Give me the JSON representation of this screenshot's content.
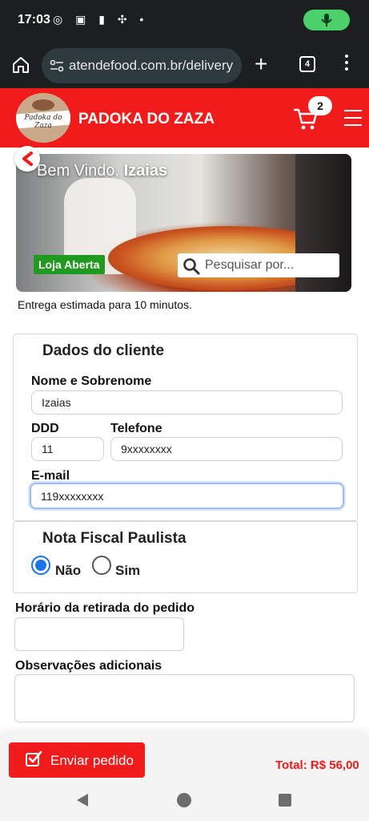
{
  "status_bar": {
    "time": "17:03",
    "notification_icons": "◎ ▣ ▮ ✣ •"
  },
  "browser": {
    "url": "atendefood.com.br/delivery",
    "tab_count": "4",
    "new_tab_symbol": "+"
  },
  "header": {
    "brand": "PADOKA DO ZAZA",
    "logo_text": "Padoka do Zaza",
    "cart_count": "2",
    "accent_color": "#f01b1b"
  },
  "banner": {
    "welcome_prefix": "Bem Vindo, ",
    "user_name": "Izaias",
    "store_status": "Loja Aberta",
    "search_placeholder": "Pesquisar por..."
  },
  "delivery_estimate": "Entrega estimada para 10 minutos.",
  "client_section": {
    "title": "Dados do cliente",
    "name_label": "Nome e Sobrenome",
    "name_value": "Izaias",
    "ddd_label": "DDD",
    "ddd_value": "11",
    "phone_label": "Telefone",
    "phone_value": "9xxxxxxxx",
    "email_label": "E-mail",
    "email_value": "119xxxxxxxx"
  },
  "nfp_section": {
    "title": "Nota Fiscal Paulista",
    "options": [
      {
        "label": "Não",
        "checked": true
      },
      {
        "label": "Sim",
        "checked": false
      }
    ]
  },
  "pickup_time": {
    "label": "Horário da retirada do pedido",
    "value": ""
  },
  "notes": {
    "label": "Observações adicionais",
    "value": ""
  },
  "footer": {
    "send_label": "Enviar pedido",
    "total": "Total: R$ 56,00"
  }
}
